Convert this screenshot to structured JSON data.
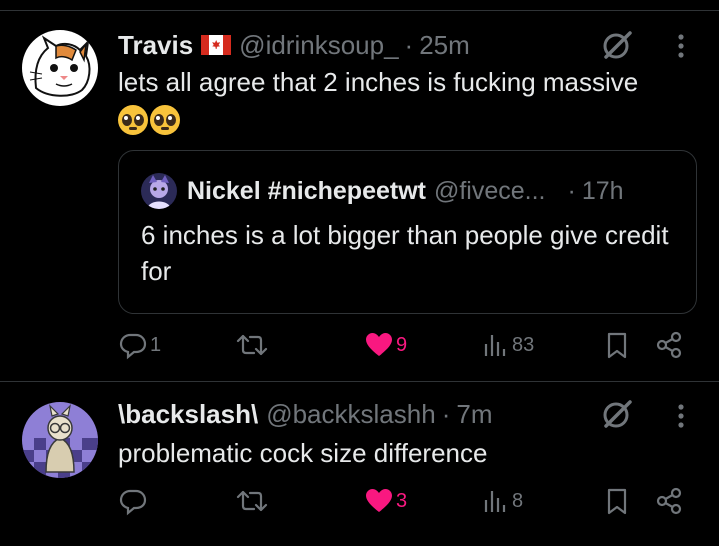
{
  "posts": [
    {
      "author": "Travis",
      "handle": "@idrinksoup_",
      "dot": "·",
      "time": "25m",
      "text": "lets all agree that 2 inches is fucking massive",
      "emoji": "pleading-face",
      "quote": {
        "author": "Nickel #nichepeetwt",
        "handle": "@fivece...",
        "dot": "·",
        "time": "17h",
        "text": "6 inches is a lot bigger than people give credit for"
      },
      "actions": {
        "replies": "1",
        "reposts": "",
        "likes": "9",
        "views": "83",
        "liked": true
      }
    },
    {
      "author": "\\backslash\\",
      "handle": "@backkslashh",
      "dot": "·",
      "time": "7m",
      "text": "problematic cock size difference",
      "actions": {
        "replies": "",
        "reposts": "",
        "likes": "3",
        "views": "8",
        "liked": true
      }
    }
  ],
  "colors": {
    "background": "#000000",
    "text": "#e7e9ea",
    "muted": "#71767b",
    "like": "#f91880",
    "border": "#2f3336"
  },
  "icons": [
    "grok-icon",
    "more-icon",
    "reply-icon",
    "repost-icon",
    "like-icon",
    "views-icon",
    "bookmark-icon",
    "share-icon",
    "canada-flag-icon"
  ]
}
